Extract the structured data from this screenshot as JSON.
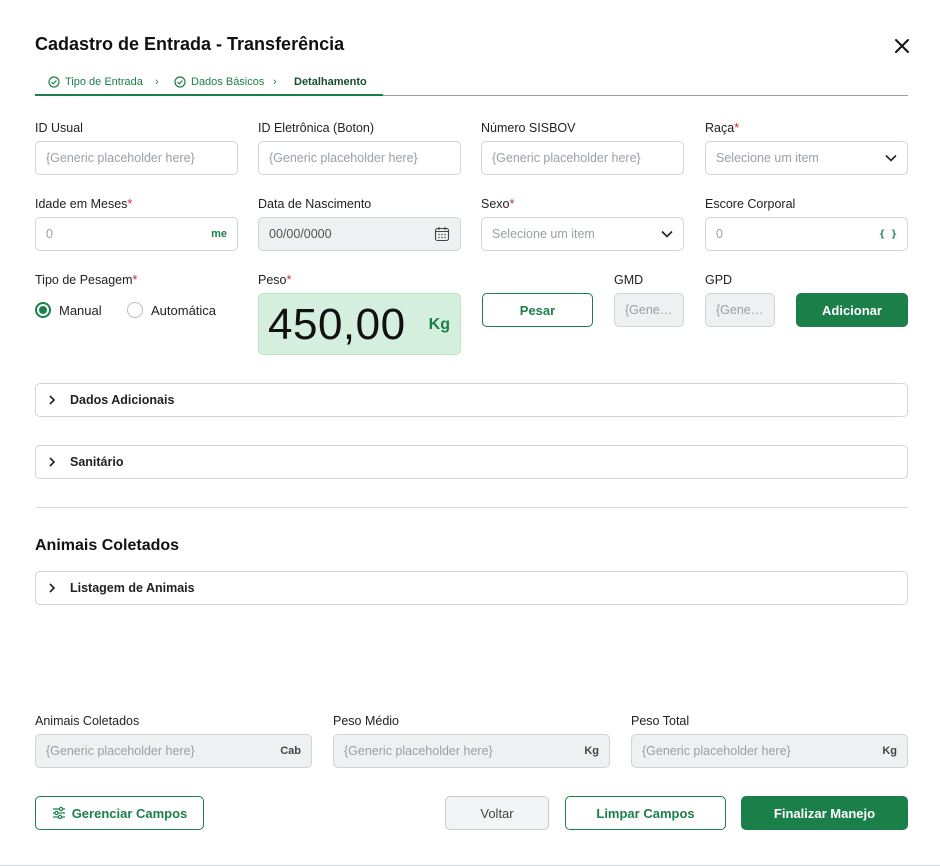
{
  "modal": {
    "title": "Cadastro de Entrada - Transferência"
  },
  "steps": [
    {
      "label": "Tipo de Entrada",
      "done": true
    },
    {
      "label": "Dados Básicos",
      "done": true
    },
    {
      "label": "Detalhamento",
      "done": false
    }
  ],
  "fields": {
    "id_usual": {
      "label": "ID Usual",
      "placeholder": "{Generic placeholder here}"
    },
    "id_eletronica": {
      "label": "ID Eletrônica (Boton)",
      "placeholder": "{Generic placeholder here}"
    },
    "numero_sisbov": {
      "label": "Número SISBOV",
      "placeholder": "{Generic placeholder here}"
    },
    "raca": {
      "label": "Raça",
      "required": "*",
      "placeholder": "Selecione um item"
    },
    "idade_meses": {
      "label": "Idade em Meses",
      "required": "*",
      "value": "0",
      "suffix": "me"
    },
    "data_nascimento": {
      "label": "Data de Nascimento",
      "value": "00/00/0000"
    },
    "sexo": {
      "label": "Sexo",
      "required": "*",
      "placeholder": "Selecione um item"
    },
    "escore_corporal": {
      "label": "Escore Corporal",
      "value": "0",
      "suffix": "{ }"
    },
    "tipo_pesagem": {
      "label": "Tipo de Pesagem",
      "required": "*",
      "options": [
        "Manual",
        "Automática"
      ],
      "selected": "Manual"
    },
    "peso": {
      "label": "Peso",
      "required": "*",
      "value": "450,00",
      "unit": "Kg"
    },
    "gmd": {
      "label": "GMD",
      "placeholder": "{Gener..."
    },
    "gpd": {
      "label": "GPD",
      "placeholder": "{Gener..."
    }
  },
  "buttons": {
    "pesar": "Pesar",
    "adicionar": "Adicionar",
    "gerenciar_campos": "Gerenciar Campos",
    "voltar": "Voltar",
    "limpar_campos": "Limpar Campos",
    "finalizar_manejo": "Finalizar Manejo"
  },
  "accordions": {
    "dados_adicionais": "Dados Adicionais",
    "sanitario": "Sanitário",
    "listagem_animais": "Listagem de Animais"
  },
  "section": {
    "animais_coletados_title": "Animais Coletados"
  },
  "summary": {
    "animais_coletados": {
      "label": "Animais Coletados",
      "placeholder": "{Generic placeholder here}",
      "suffix": "Cab"
    },
    "peso_medio": {
      "label": "Peso Médio",
      "placeholder": "{Generic placeholder here}",
      "suffix": "Kg"
    },
    "peso_total": {
      "label": "Peso Total",
      "placeholder": "{Generic placeholder here}",
      "suffix": "Kg"
    }
  },
  "colors": {
    "accent": "#1b7f4a",
    "weight_bg": "#d4efdd",
    "required": "#d0272b"
  },
  "icons": [
    "close-icon",
    "check-circle-icon",
    "breadcrumb-chevron-icon",
    "chevron-down-icon",
    "calendar-icon",
    "chevron-right-icon",
    "sliders-icon"
  ]
}
